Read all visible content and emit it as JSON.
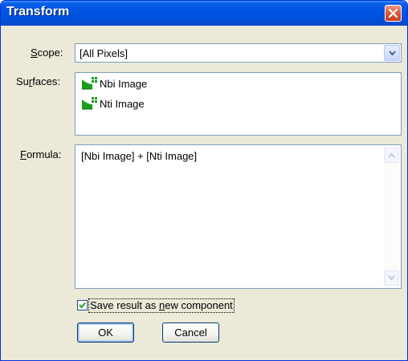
{
  "window": {
    "title": "Transform"
  },
  "labels": {
    "scope_pre": "",
    "scope_u": "S",
    "scope_post": "cope:",
    "surfaces_pre": "Su",
    "surfaces_u": "r",
    "surfaces_post": "faces:",
    "formula_pre": "",
    "formula_u": "F",
    "formula_post": "ormula:"
  },
  "scope": {
    "selected": "[All Pixels]"
  },
  "surfaces": [
    {
      "label": "Nbi Image",
      "icon": "surface-icon"
    },
    {
      "label": "Nti Image",
      "icon": "surface-icon"
    }
  ],
  "formula": {
    "text": "[Nbi Image] + [Nti Image]"
  },
  "save_checkbox": {
    "checked": true,
    "pre": "Save result as ",
    "u": "n",
    "post": "ew component"
  },
  "buttons": {
    "ok": "OK",
    "cancel": "Cancel"
  },
  "colors": {
    "titlebar": "#0054e3",
    "dialog_bg": "#ece9d8",
    "close": "#e0593a",
    "icon_green": "#1a9e1a"
  }
}
